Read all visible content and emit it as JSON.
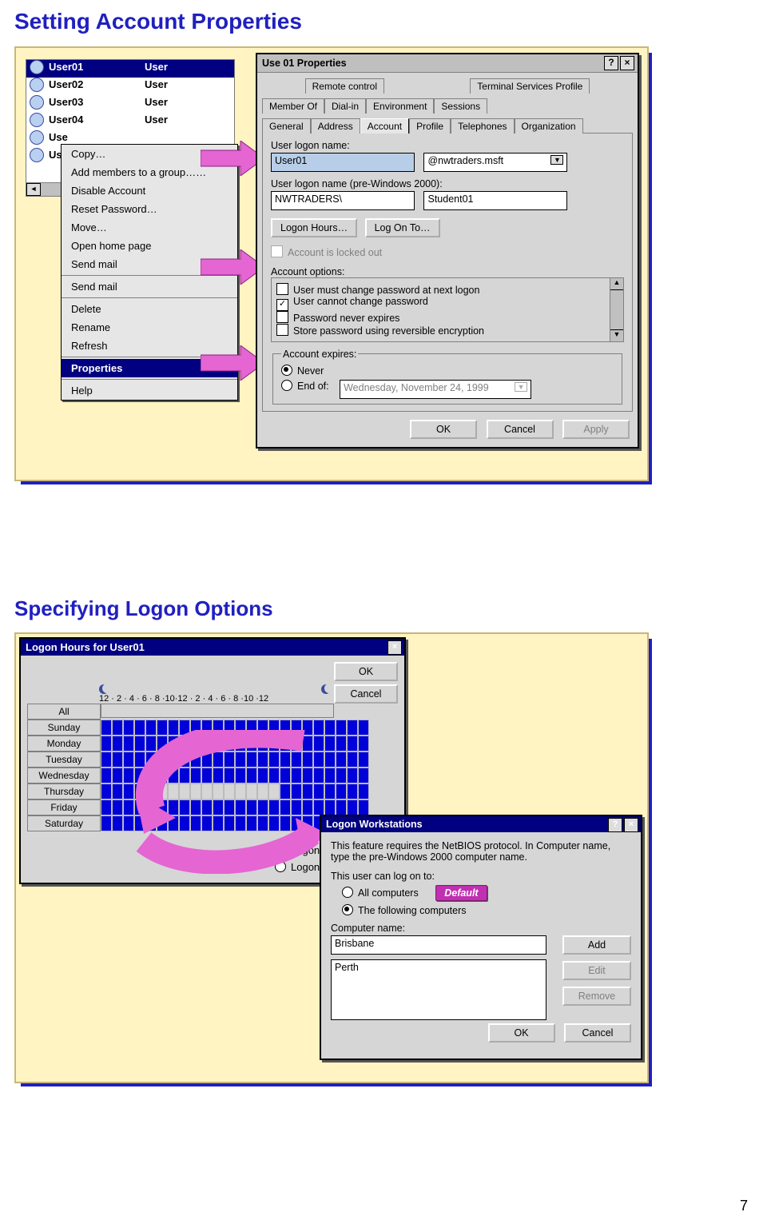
{
  "slide1": {
    "title": "Setting Account Properties",
    "user_list": [
      {
        "name": "User01",
        "type": "User",
        "selected": true
      },
      {
        "name": "User02",
        "type": "User"
      },
      {
        "name": "User03",
        "type": "User"
      },
      {
        "name": "User04",
        "type": "User"
      },
      {
        "name": "Use",
        "type": ""
      },
      {
        "name": "Use",
        "type": ""
      }
    ],
    "context_menu": {
      "items": [
        {
          "label": "Copy…"
        },
        {
          "label": "Add members to a group……"
        },
        {
          "label": "Disable Account"
        },
        {
          "label": "Reset Password…"
        },
        {
          "label": "Move…"
        },
        {
          "label": "Open home page"
        },
        {
          "label": "Send mail"
        },
        {
          "sep": true
        },
        {
          "label": "Send mail"
        },
        {
          "sep": true
        },
        {
          "label": "Delete"
        },
        {
          "label": "Rename"
        },
        {
          "label": "Refresh"
        },
        {
          "sep": true
        },
        {
          "label": "Properties",
          "selected": true
        },
        {
          "sep": true
        },
        {
          "label": "Help"
        }
      ]
    },
    "dialog": {
      "title": "Use 01 Properties",
      "tabs_row1": [
        "Remote control",
        "Terminal Services Profile"
      ],
      "tabs_row2": [
        "Member Of",
        "Dial-in",
        "Environment",
        "Sessions"
      ],
      "tabs_row3": [
        "General",
        "Address",
        "Account",
        "Profile",
        "Telephones",
        "Organization"
      ],
      "logon_name_label": "User logon name:",
      "logon_name_value": "User01",
      "domain_value": "@nwtraders.msft",
      "pre2000_label": "User logon name (pre-Windows 2000):",
      "pre2000_domain": "NWTRADERS\\",
      "pre2000_user": "Student01",
      "logon_hours_btn": "Logon Hours…",
      "logonto_btn": "Log On To…",
      "locked_checkbox": "Account is locked out",
      "options_label": "Account options:",
      "options": [
        {
          "label": "User must change password at next logon",
          "checked": false
        },
        {
          "label": "User cannot change password",
          "checked": true
        },
        {
          "label": "Password never expires",
          "checked": false
        },
        {
          "label": "Store password using reversible encryption",
          "checked": false
        }
      ],
      "expires_label": "Account expires:",
      "never_label": "Never",
      "endof_label": "End of:",
      "endof_value": "Wednesday, November 24, 1999",
      "ok": "OK",
      "cancel": "Cancel",
      "apply": "Apply"
    }
  },
  "slide2": {
    "title": "Specifying Logon Options",
    "logon_hours": {
      "title": "Logon Hours for User01",
      "ok": "OK",
      "cancel": "Cancel",
      "ticks": "12 · 2 · 4 · 6 · 8 ·10·12 · 2 · 4 · 6 · 8 ·10 ·12",
      "all": "All",
      "days": [
        "Sunday",
        "Monday",
        "Tuesday",
        "Wednesday",
        "Thursday",
        "Friday",
        "Saturday"
      ],
      "off_days": [
        "Thursday"
      ],
      "off_start": 4,
      "off_end": 16,
      "permitted": "Logon Permitted",
      "denied": "Logon Denied"
    },
    "workstations": {
      "title": "Logon Workstations",
      "msg": "This feature requires the NetBIOS protocol. In Computer name, type the pre-Windows 2000 computer name.",
      "can_label": "This user can log on to:",
      "all_computers": "All computers",
      "following": "The following computers",
      "computer_name_label": "Computer name:",
      "input_value": "Brisbane",
      "list": [
        "Perth"
      ],
      "add": "Add",
      "edit": "Edit",
      "remove": "Remove",
      "ok": "OK",
      "cancel": "Cancel",
      "default_badge": "Default"
    }
  },
  "page_number": "7"
}
